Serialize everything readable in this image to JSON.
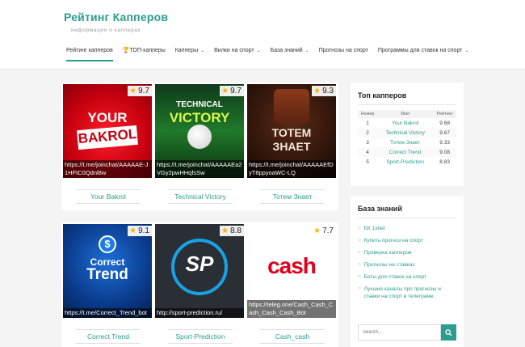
{
  "site": {
    "title": "Рейтинг Капперов",
    "description": "информация о капперах"
  },
  "nav": [
    {
      "label": "Рейтинг капперов",
      "active": true,
      "dropdown": false
    },
    {
      "label": "ТОП-капперы",
      "icon": "trophy-icon",
      "dropdown": false
    },
    {
      "label": "Капперы",
      "dropdown": true
    },
    {
      "label": "Вилки на спорт",
      "dropdown": true
    },
    {
      "label": "База знаний",
      "dropdown": true
    },
    {
      "label": "Прогнозы на спорт",
      "dropdown": false
    },
    {
      "label": "Программы для ставок на спорт",
      "dropdown": true
    }
  ],
  "cards": [
    {
      "title": "Your Bakrol",
      "rating": "9.7",
      "link": "https://t.me/joinchat/AAAAAE-J1HFtC0Qdnl8w",
      "art": "YOUR BAKROL"
    },
    {
      "title": "Technical Victory",
      "rating": "9.7",
      "link": "https://t.me/joinchat/AAAAAEa2VGy2pwHHqfsSw",
      "art": "TECHNICAL VICTORY"
    },
    {
      "title": "Тотем Знает",
      "rating": "9.3",
      "link": "https://t.me/joinchat/AAAAAEfDyT8ppyoaWC-LQ",
      "art": "ТОТЕМ ЗНАЕТ"
    },
    {
      "title": "Correct Trend",
      "rating": "9.1",
      "link": "https://t.me/Correct_Trend_bot",
      "art": "Correct Trend"
    },
    {
      "title": "Sport-Prediction",
      "rating": "8.8",
      "link": "http://sport-prediction.ru/",
      "art": "SP"
    },
    {
      "title": "Cash_cash",
      "rating": "7.7",
      "link": "https://teleg.one/Cash_Cash_Cash_Cash_Cash_Bot",
      "art": "cash"
    }
  ],
  "top": {
    "title": "Топ капперов",
    "headers": [
      "Номер",
      "Имя",
      "Рейтинг"
    ],
    "rows": [
      {
        "num": "1",
        "name": "Your Bakrol",
        "rating": "9.68"
      },
      {
        "num": "2",
        "name": "Technical Victory",
        "rating": "9.67"
      },
      {
        "num": "3",
        "name": "Тотем Знает",
        "rating": "9.33"
      },
      {
        "num": "4",
        "name": "Correct Trend",
        "rating": "9.08"
      },
      {
        "num": "5",
        "name": "Sport-Prediction",
        "rating": "8.83"
      }
    ]
  },
  "knowledge": {
    "title": "База знаний",
    "items": [
      "БК 1xbet",
      "Купить прогноз на спорт",
      "Проверка капперов",
      "Прогнозы на ставках",
      "Боты для ставок на спорт",
      "Лучшие каналы про прогнозы и ставки на спорт в телеграме"
    ]
  },
  "search": {
    "placeholder": "Search..."
  },
  "colors": {
    "accent": "#2a9d8f"
  }
}
